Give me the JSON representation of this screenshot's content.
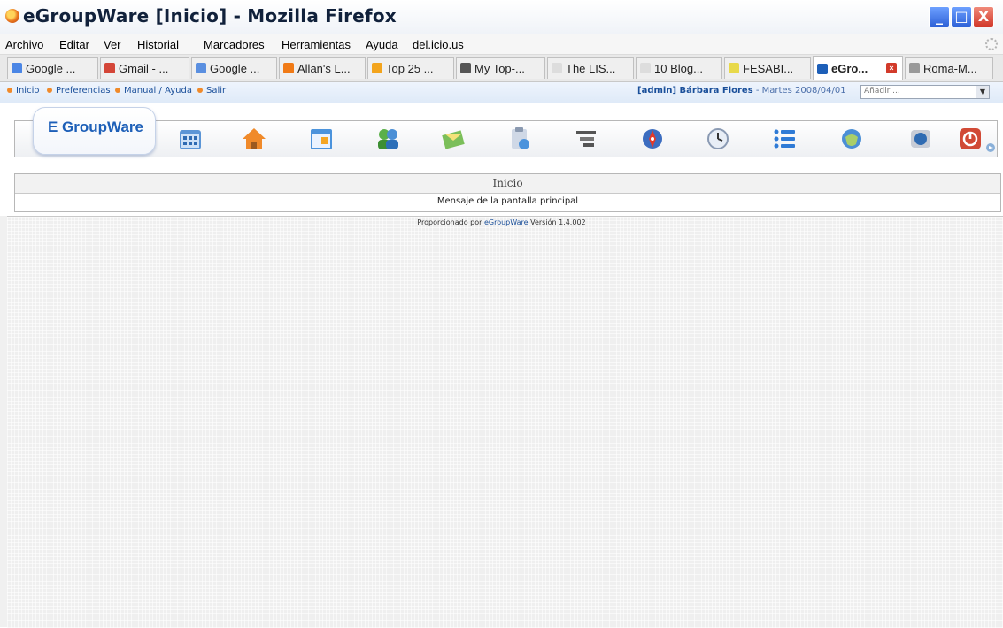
{
  "window": {
    "title": "eGroupWare [Inicio] - Mozilla Firefox",
    "minimize_glyph": "_",
    "maximize_glyph": "□",
    "close_glyph": "X"
  },
  "menubar": {
    "items": [
      "Archivo",
      "Editar",
      "Ver",
      "Historial",
      "Marcadores",
      "Herramientas",
      "Ayuda",
      "del.icio.us"
    ]
  },
  "tabs": [
    {
      "label": "Google ...",
      "icon_color": "#4b86e5"
    },
    {
      "label": "Gmail - ...",
      "icon_color": "#d44638",
      "icon_text": "M"
    },
    {
      "label": "Google ...",
      "icon_color": "#5a8fe0"
    },
    {
      "label": "Allan's L...",
      "icon_color": "#f07a16"
    },
    {
      "label": "Top 25 ...",
      "icon_color": "#f3a41c"
    },
    {
      "label": "My Top-...",
      "icon_color": "#555555"
    },
    {
      "label": "The LIS...",
      "icon_color": "#dddddd"
    },
    {
      "label": "10 Blog...",
      "icon_color": "#dddddd"
    },
    {
      "label": "FESABI...",
      "icon_color": "#e8d94a"
    },
    {
      "label": "eGro...",
      "icon_color": "#1d5fb8",
      "active": true
    },
    {
      "label": "Roma-M...",
      "icon_color": "#999999"
    }
  ],
  "egw_top": {
    "links": [
      "Inicio",
      "Preferencias",
      "Manual / Ayuda",
      "Salir"
    ],
    "user": "[admin] Bárbara Flores",
    "date": " - Martes 2008/04/01",
    "add_placeholder": "Añadir ...",
    "select_arrow": "▼"
  },
  "navbar": {
    "logo_text": "E GroupWare",
    "apps": [
      {
        "name": "calendar-grid-icon"
      },
      {
        "name": "home-icon"
      },
      {
        "name": "calendar-icon"
      },
      {
        "name": "addressbook-icon"
      },
      {
        "name": "email-icon"
      },
      {
        "name": "infolog-icon"
      },
      {
        "name": "projects-icon"
      },
      {
        "name": "resources-icon"
      },
      {
        "name": "timesheet-icon"
      },
      {
        "name": "list-icon"
      },
      {
        "name": "wiki-icon"
      },
      {
        "name": "sitemgr-icon"
      },
      {
        "name": "logout-icon"
      }
    ]
  },
  "main": {
    "title": "Inicio",
    "message": "Mensaje de la pantalla principal"
  },
  "footer": {
    "prefix": "Proporcionado por ",
    "link": "eGroupWare",
    "suffix": " Versión 1.4.002"
  }
}
